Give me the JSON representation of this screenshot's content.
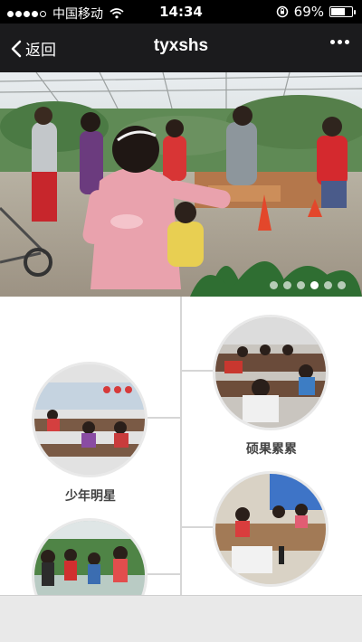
{
  "status_bar": {
    "carrier": "中国移动",
    "time": "14:34",
    "battery": "69%",
    "battery_level": 0.69
  },
  "nav": {
    "back_label": "返回",
    "title": "tyxshs",
    "more_icon": "ellipsis-icon"
  },
  "banner": {
    "slides": 6,
    "active_index": 3
  },
  "timeline": {
    "items": [
      {
        "label": "硕果累累",
        "side": "right"
      },
      {
        "label": "少年明星",
        "side": "left"
      },
      {
        "label": "",
        "side": "right"
      },
      {
        "label": "",
        "side": "left"
      }
    ]
  }
}
